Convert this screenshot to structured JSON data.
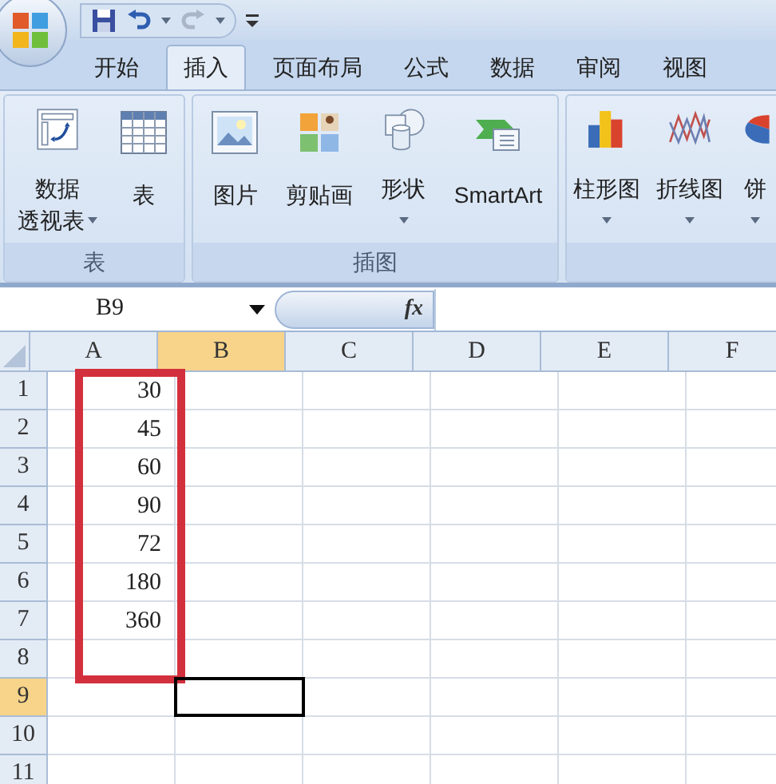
{
  "tabs": [
    {
      "label": "开始",
      "selected": false
    },
    {
      "label": "插入",
      "selected": true
    },
    {
      "label": "页面布局",
      "selected": false
    },
    {
      "label": "公式",
      "selected": false
    },
    {
      "label": "数据",
      "selected": false
    },
    {
      "label": "审阅",
      "selected": false
    },
    {
      "label": "视图",
      "selected": false
    }
  ],
  "ribbon": {
    "groups": [
      {
        "label": "表",
        "items": [
          {
            "kind": "pivot",
            "lines": [
              "数据",
              "透视表"
            ],
            "menu": true
          },
          {
            "kind": "table",
            "lines": [
              "表"
            ],
            "menu": false
          }
        ]
      },
      {
        "label": "插图",
        "items": [
          {
            "kind": "picture",
            "lines": [
              "图片"
            ],
            "menu": false
          },
          {
            "kind": "clipart",
            "lines": [
              "剪贴画"
            ],
            "menu": false
          },
          {
            "kind": "shapes",
            "lines": [
              "形状"
            ],
            "menu": true
          },
          {
            "kind": "smartart",
            "lines": [
              "SmartArt"
            ],
            "menu": false
          }
        ]
      },
      {
        "items": [
          {
            "kind": "bar",
            "lines": [
              "柱形图"
            ],
            "menu": true
          },
          {
            "kind": "line",
            "lines": [
              "折线图"
            ],
            "menu": true
          },
          {
            "kind": "pie",
            "lines": [
              "饼"
            ],
            "menu": true
          }
        ]
      }
    ]
  },
  "formula_bar": {
    "name_box": "B9",
    "function_label": "fx"
  },
  "sheet": {
    "columns": [
      {
        "label": "A",
        "selected": false
      },
      {
        "label": "B",
        "selected": true
      },
      {
        "label": "C",
        "selected": false
      },
      {
        "label": "D",
        "selected": false
      },
      {
        "label": "E",
        "selected": false
      },
      {
        "label": "F",
        "selected": false
      }
    ],
    "rows": [
      {
        "header": "1",
        "selected": false,
        "highlighted": true,
        "cells": [
          "30"
        ]
      },
      {
        "header": "2",
        "selected": false,
        "highlighted": true,
        "cells": [
          "45"
        ]
      },
      {
        "header": "3",
        "selected": false,
        "highlighted": true,
        "cells": [
          "60"
        ]
      },
      {
        "header": "4",
        "selected": false,
        "highlighted": true,
        "cells": [
          "90"
        ]
      },
      {
        "header": "5",
        "selected": false,
        "highlighted": true,
        "cells": [
          "72"
        ]
      },
      {
        "header": "6",
        "selected": false,
        "highlighted": true,
        "cells": [
          "180"
        ]
      },
      {
        "header": "7",
        "selected": false,
        "highlighted": true,
        "cells": [
          "360"
        ]
      },
      {
        "header": "8",
        "selected": false,
        "highlighted": true,
        "cells": []
      },
      {
        "header": "9",
        "selected": true,
        "highlighted": false,
        "cells": []
      },
      {
        "header": "10",
        "selected": false,
        "highlighted": false,
        "cells": []
      },
      {
        "header": "11",
        "selected": false,
        "highlighted": false,
        "cells": []
      }
    ]
  }
}
